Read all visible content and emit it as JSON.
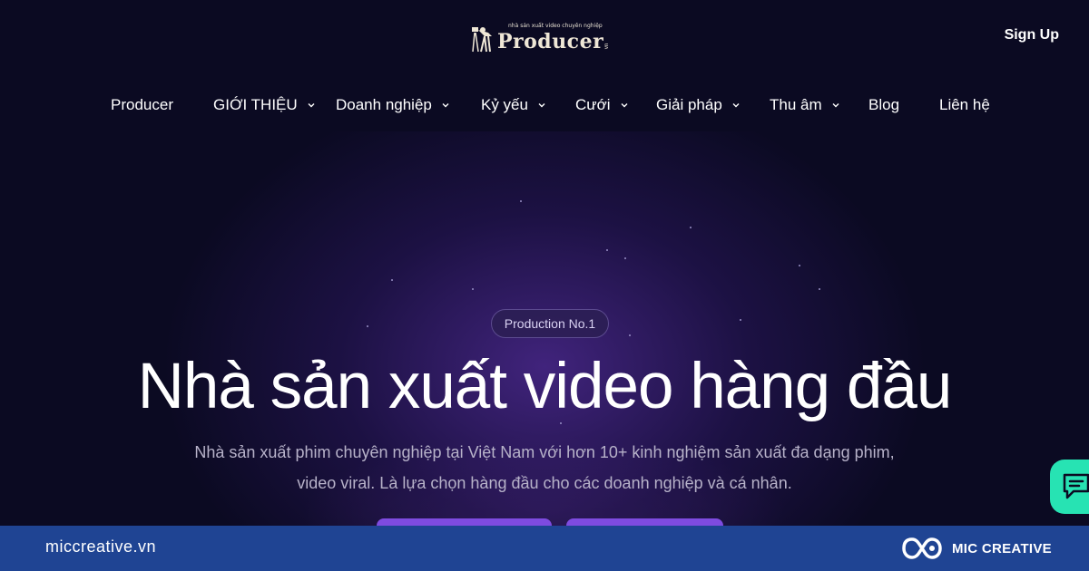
{
  "header": {
    "logo": {
      "tagline": "nhà sản xuất video chuyên nghiệp",
      "wordmark": "Producer",
      "suffix": "vn"
    },
    "signup_label": "Sign Up"
  },
  "nav": {
    "items": [
      {
        "label": "Producer",
        "has_dropdown": false
      },
      {
        "label": "GIỚI THIỆU",
        "has_dropdown": true
      },
      {
        "label": "Doanh nghiệp",
        "has_dropdown": true
      },
      {
        "label": "Kỷ yếu",
        "has_dropdown": true
      },
      {
        "label": "Cưới",
        "has_dropdown": true
      },
      {
        "label": "Giải pháp",
        "has_dropdown": true
      },
      {
        "label": "Thu âm",
        "has_dropdown": true
      },
      {
        "label": "Blog",
        "has_dropdown": false
      },
      {
        "label": "Liên hệ",
        "has_dropdown": false
      }
    ]
  },
  "hero": {
    "badge": "Production No.1",
    "headline": "Nhà sản xuất video hàng đầu",
    "subtext_line1": "Nhà sản xuất phim chuyên nghiệp tại Việt Nam với hơn 10+ kinh nghiệm sản xuất đa dạng phim,",
    "subtext_line2": "video viral. Là lựa chọn hàng đầu cho các doanh nghiệp và cá nhân."
  },
  "chat_widget": {
    "icon": "chat-icon",
    "color": "#27e3b3"
  },
  "footer": {
    "domain": "miccreative.vn",
    "brand": "MIC CREATIVE"
  },
  "colors": {
    "background": "#0b0a22",
    "accent": "#7e4be0",
    "footer_bg": "#1f4493"
  }
}
